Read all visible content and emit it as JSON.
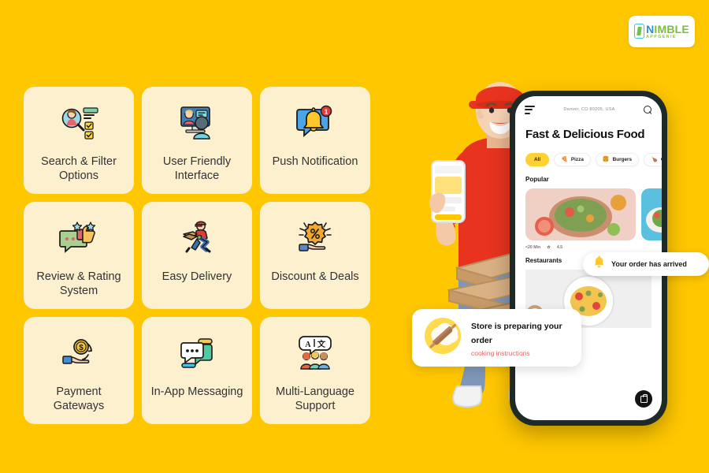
{
  "brand": {
    "logo_name_1": "N",
    "logo_name_2": "IMBLE",
    "logo_sub": "APPGENIE",
    "accent_yellow": "#FFC700",
    "card_cream": "#FDF0CE",
    "chip_yellow": "#FFD233",
    "toast_red": "#F0625E"
  },
  "features": [
    {
      "label": "Search & Filter Options",
      "icon": "search-filter-icon"
    },
    {
      "label": "User Friendly Interface",
      "icon": "user-interface-icon"
    },
    {
      "label": "Push Notification",
      "icon": "bell-notification-icon"
    },
    {
      "label": "Review & Rating System",
      "icon": "thumbs-up-stars-icon"
    },
    {
      "label": "Easy Delivery",
      "icon": "delivery-runner-icon"
    },
    {
      "label": "Discount & Deals",
      "icon": "discount-hand-icon"
    },
    {
      "label": "Payment Gateways",
      "icon": "coin-hand-icon"
    },
    {
      "label": "In-App Messaging",
      "icon": "chat-bubbles-icon"
    },
    {
      "label": "Multi-Language Support",
      "icon": "translate-people-icon"
    }
  ],
  "phone": {
    "location": "Denver, CO 80205, USA",
    "menu_icon": "hamburger-menu-icon",
    "search_icon": "search-icon",
    "title": "Fast & Delicious Food",
    "chips": [
      {
        "label": "All",
        "glyph": "",
        "active": true
      },
      {
        "label": "Pizza",
        "glyph": "🍕",
        "active": false
      },
      {
        "label": "Burgers",
        "glyph": "🍔",
        "active": false
      },
      {
        "label": "Gr",
        "glyph": "🍗",
        "active": false
      }
    ],
    "section_popular": "Popular",
    "meta_time": "<20 Min",
    "meta_rating": "4.5",
    "section_restaurants": "Restaurants",
    "cart_icon": "shopping-bag-icon"
  },
  "toasts": {
    "arrived": {
      "text": "Your order has arrived",
      "icon": "bell-icon"
    },
    "store": {
      "title": "Store is preparing your order",
      "link": "cooking instructions",
      "icon": "rolling-pin-icon"
    }
  }
}
